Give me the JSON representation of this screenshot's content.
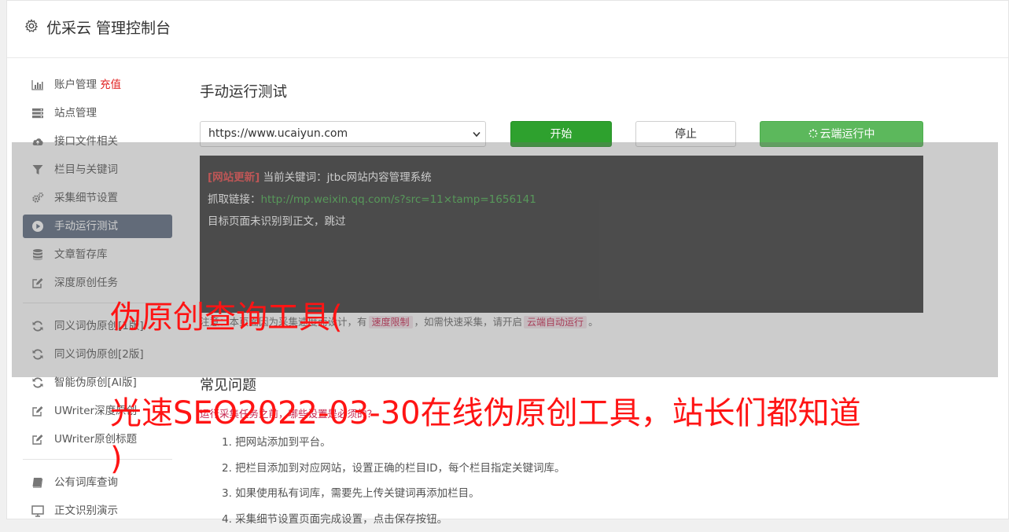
{
  "header": {
    "title": "优采云 管理控制台",
    "icon": "gear-icon"
  },
  "sidebar": {
    "items": [
      {
        "label": "账户管理",
        "extra": "充值",
        "icon": "bar-chart-icon"
      },
      {
        "label": "站点管理",
        "icon": "server-icon"
      },
      {
        "label": "接口文件相关",
        "icon": "cloud-upload-icon"
      },
      {
        "label": "栏目与关键词",
        "icon": "filter-icon"
      },
      {
        "label": "采集细节设置",
        "icon": "gears-icon"
      },
      {
        "label": "手动运行测试",
        "icon": "play-circle-icon",
        "active": true
      },
      {
        "label": "文章暂存库",
        "icon": "database-icon"
      },
      {
        "label": "深度原创任务",
        "icon": "edit-icon"
      },
      {
        "label": "同义词伪原创[1版]",
        "icon": "refresh-icon"
      },
      {
        "label": "同义词伪原创[2版]",
        "icon": "refresh-icon"
      },
      {
        "label": "智能伪原创[AI版]",
        "icon": "refresh-icon"
      },
      {
        "label": "UWriter深度原创",
        "icon": "edit-icon"
      },
      {
        "label": "UWriter原创标题",
        "icon": "edit-icon"
      },
      {
        "label": "公有词库查询",
        "icon": "book-icon"
      },
      {
        "label": "正文识别演示",
        "icon": "monitor-icon"
      }
    ]
  },
  "main": {
    "title": "手动运行测试",
    "site_select": {
      "value": "https://www.ucaiyun.com"
    },
    "buttons": {
      "start": "开始",
      "stop": "停止",
      "cloud": "云端运行中"
    },
    "console": {
      "line1_tag": "[网站更新]",
      "line1_text": "当前关键词：jtbc网站内容管理系统",
      "line2_label": "抓取链接：",
      "line2_link": "http://mp.weixin.qq.com/s?src=11×tamp=1656141",
      "line3": "目标页面未识别到正文，跳过"
    },
    "note": {
      "part1": "注意：本页面因为采集速度而设计，有",
      "code1": "速度限制",
      "part2": "，如需快速采集，请开启",
      "code2": "云端自动运行",
      "part3": "。"
    },
    "faq": {
      "title": "常见问题",
      "question": "运行采集任务之前，哪些设置是必须的？",
      "steps": [
        "1. 把网站添加到平台。",
        "2. 把栏目添加到对应网站，设置正确的栏目ID，每个栏目指定关键词库。",
        "3. 如果使用私有词库，需要先上传关键词再添加栏目。",
        "4. 采集细节设置页面完成设置，点击保存按钮。"
      ]
    }
  },
  "watermark": {
    "line1": "伪原创查询工具(",
    "line2": "光速SEO2022-03-30在线伪原创工具，站长们都知道",
    "line3": ")"
  },
  "colors": {
    "active_bg": "#5d6b80",
    "start_btn": "#2ea12e",
    "cloud_btn": "#5cb85c",
    "watermark": "#ff1414"
  }
}
